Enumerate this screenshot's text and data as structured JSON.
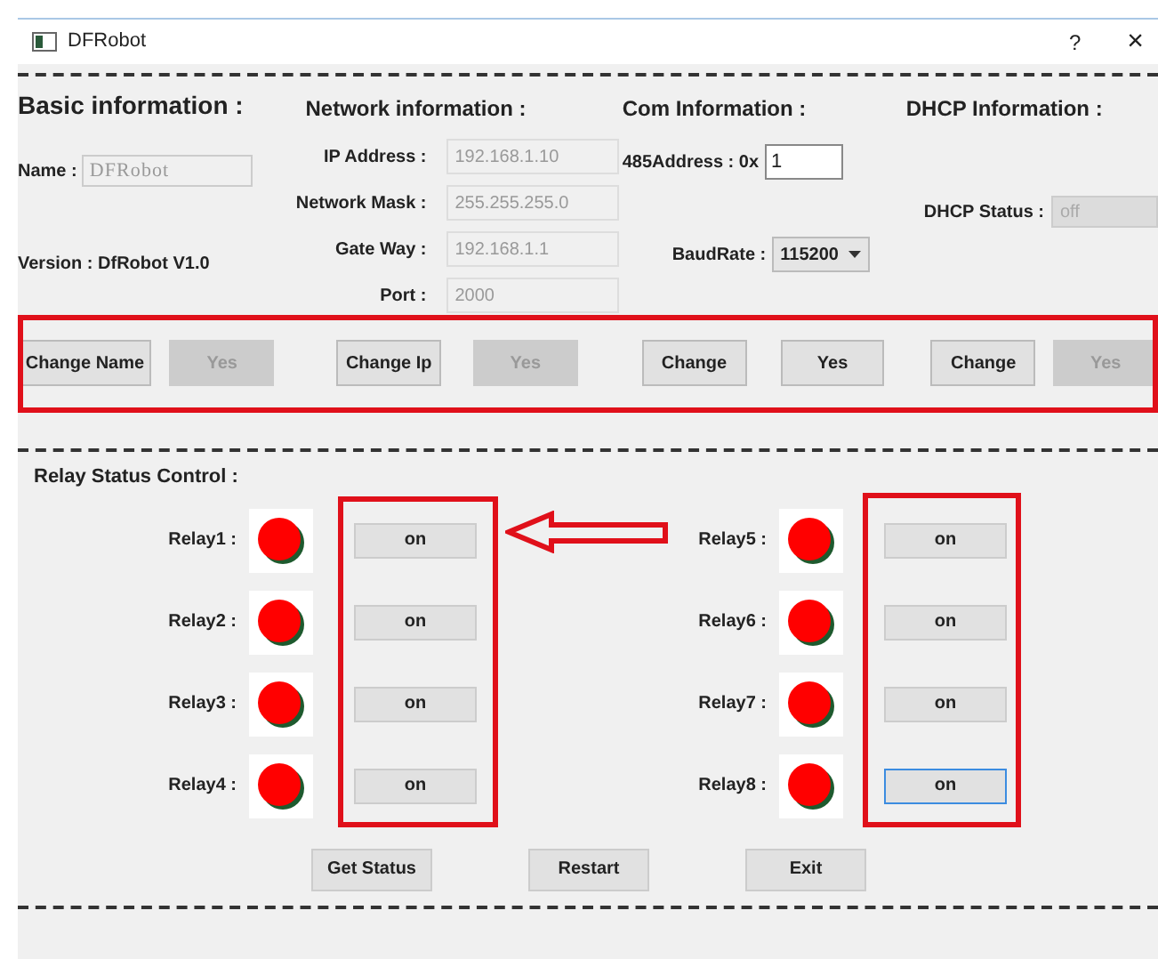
{
  "window": {
    "title": "DFRobot",
    "help": "?",
    "close": "×"
  },
  "basic": {
    "heading": "Basic information :",
    "name_label": "Name :",
    "name_value": "DFRobot",
    "name_disabled": true,
    "version": "Version : DfRobot V1.0"
  },
  "network": {
    "heading": "Network information :",
    "fields": [
      {
        "label": "IP Address :",
        "value": "192.168.1.10",
        "disabled": true
      },
      {
        "label": "Network Mask :",
        "value": "255.255.255.0",
        "disabled": true
      },
      {
        "label": "Gate Way :",
        "value": "192.168.1.1",
        "disabled": true
      },
      {
        "label": "Port :",
        "value": "2000",
        "disabled": true
      }
    ]
  },
  "com": {
    "heading": "Com Information :",
    "address_label": "485Address : 0x",
    "address_value": "1",
    "address_disabled": false,
    "baud_label": "BaudRate :",
    "baud_value": "115200"
  },
  "dhcp": {
    "heading": "DHCP Information :",
    "status_label": "DHCP Status :",
    "status_value": "off",
    "disabled": true
  },
  "change_buttons": [
    {
      "label": "Change Name",
      "disabled": false
    },
    {
      "label": "Yes",
      "disabled": true
    },
    {
      "label": "Change Ip",
      "disabled": false
    },
    {
      "label": "Yes",
      "disabled": true
    },
    {
      "label": "Change",
      "disabled": false
    },
    {
      "label": "Yes",
      "disabled": false
    },
    {
      "label": "Change",
      "disabled": false
    },
    {
      "label": "Yes",
      "disabled": true
    }
  ],
  "relay_heading": "Relay Status Control :",
  "relays": [
    {
      "label": "Relay1 :",
      "button": "on",
      "focused": false,
      "color": "#ff0000"
    },
    {
      "label": "Relay2 :",
      "button": "on",
      "focused": false,
      "color": "#ff0000"
    },
    {
      "label": "Relay3 :",
      "button": "on",
      "focused": false,
      "color": "#ff0000"
    },
    {
      "label": "Relay4 :",
      "button": "on",
      "focused": false,
      "color": "#ff0000"
    },
    {
      "label": "Relay5 :",
      "button": "on",
      "focused": false,
      "color": "#ff0000"
    },
    {
      "label": "Relay6 :",
      "button": "on",
      "focused": false,
      "color": "#ff0000"
    },
    {
      "label": "Relay7 :",
      "button": "on",
      "focused": false,
      "color": "#ff0000"
    },
    {
      "label": "Relay8 :",
      "button": "on",
      "focused": true,
      "color": "#ff0000"
    }
  ],
  "bottom_buttons": [
    "Get Status",
    "Restart",
    "Exit"
  ]
}
